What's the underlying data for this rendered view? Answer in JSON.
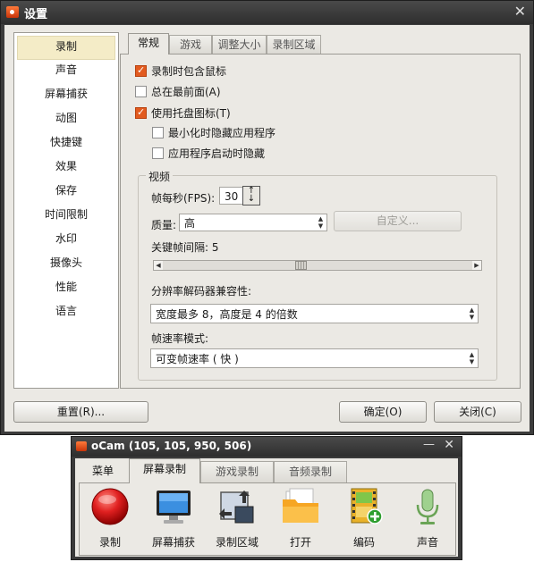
{
  "settings": {
    "title": "设置",
    "close_symbol": "✕",
    "nav": [
      "录制",
      "声音",
      "屏幕捕获",
      "动图",
      "快捷键",
      "效果",
      "保存",
      "时间限制",
      "水印",
      "摄像头",
      "性能",
      "语言"
    ],
    "tabs": [
      "常规",
      "游戏",
      "调整大小",
      "录制区域"
    ],
    "options": [
      {
        "label": "录制时包含鼠标",
        "checked": true
      },
      {
        "label": "总在最前面(A)",
        "checked": false
      },
      {
        "label": "使用托盘图标(T)",
        "checked": true
      },
      {
        "label": "最小化时隐藏应用程序",
        "checked": false
      },
      {
        "label": "应用程序启动时隐藏",
        "checked": false
      }
    ],
    "video": {
      "group_title": "视频",
      "fps_label": "帧每秒(FPS):",
      "fps_value": "30",
      "quality_label": "质量:",
      "quality_value": "高",
      "custom_button": "自定义...",
      "keyframe_label": "关键帧间隔: 5",
      "keyframe_value": 5,
      "codec_compat_label": "分辨率解码器兼容性:",
      "codec_compat_value": "宽度最多 8，高度是 4 的倍数",
      "framerate_mode_label": "帧速率模式:",
      "framerate_mode_value": "可变帧速率 ( 快 )"
    },
    "buttons": {
      "reset": "重置(R)...",
      "ok": "确定(O)",
      "close": "关闭(C)"
    }
  },
  "ocam": {
    "title": "oCam (105, 105, 950, 506)",
    "min_symbol": "—",
    "close_symbol": "✕",
    "tabs": [
      "菜单",
      "屏幕录制",
      "游戏录制",
      "音频录制"
    ],
    "active_tab": "屏幕录制",
    "tools": [
      {
        "label": "录制",
        "icon": "record-icon"
      },
      {
        "label": "屏幕捕获",
        "icon": "monitor-icon"
      },
      {
        "label": "录制区域",
        "icon": "resize-area-icon"
      },
      {
        "label": "打开",
        "icon": "folder-icon"
      },
      {
        "label": "编码",
        "icon": "film-plus-icon"
      },
      {
        "label": "声音",
        "icon": "microphone-icon"
      }
    ]
  }
}
